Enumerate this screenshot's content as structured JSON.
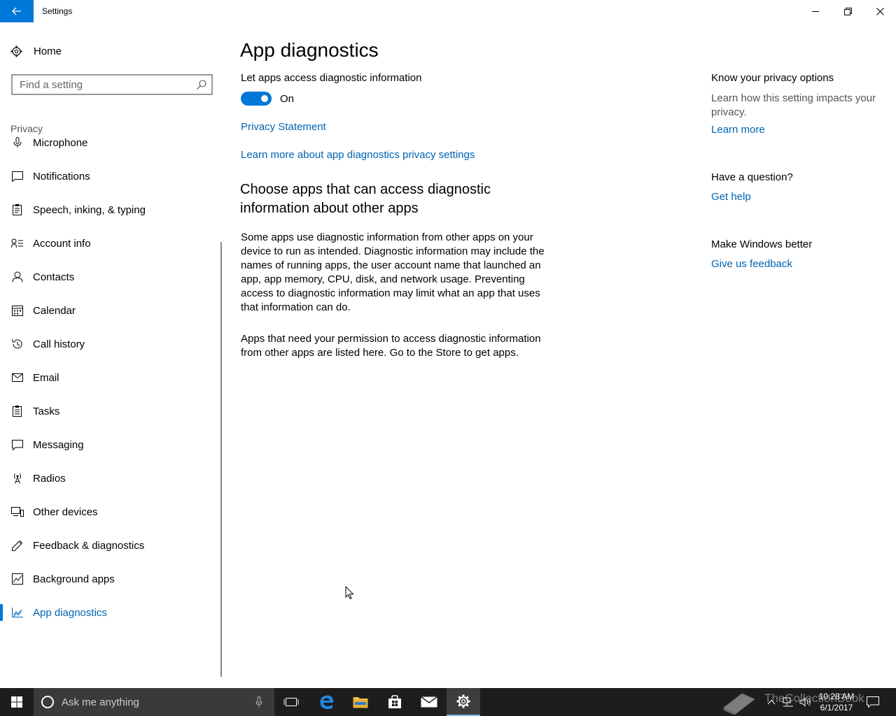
{
  "window": {
    "title": "Settings",
    "colors": {
      "accent": "#0078d7",
      "link": "#0063b1",
      "taskbar": "#1d1d1d"
    }
  },
  "sidebar": {
    "home_label": "Home",
    "search_placeholder": "Find a setting",
    "section_label": "Privacy",
    "items": [
      {
        "label": "Microphone",
        "icon": "microphone-icon"
      },
      {
        "label": "Notifications",
        "icon": "notifications-icon"
      },
      {
        "label": "Speech, inking, & typing",
        "icon": "speech-icon"
      },
      {
        "label": "Account info",
        "icon": "account-info-icon"
      },
      {
        "label": "Contacts",
        "icon": "contacts-icon"
      },
      {
        "label": "Calendar",
        "icon": "calendar-icon"
      },
      {
        "label": "Call history",
        "icon": "call-history-icon"
      },
      {
        "label": "Email",
        "icon": "email-icon"
      },
      {
        "label": "Tasks",
        "icon": "tasks-icon"
      },
      {
        "label": "Messaging",
        "icon": "messaging-icon"
      },
      {
        "label": "Radios",
        "icon": "radios-icon"
      },
      {
        "label": "Other devices",
        "icon": "other-devices-icon"
      },
      {
        "label": "Feedback & diagnostics",
        "icon": "feedback-icon"
      },
      {
        "label": "Background apps",
        "icon": "background-apps-icon"
      },
      {
        "label": "App diagnostics",
        "icon": "app-diagnostics-icon",
        "selected": true
      }
    ]
  },
  "main": {
    "title": "App diagnostics",
    "toggle_label": "Let apps access diagnostic information",
    "toggle_state": "On",
    "privacy_link": "Privacy Statement",
    "learn_more_link": "Learn more about app diagnostics privacy settings",
    "section_heading": "Choose apps that can access diagnostic information about other apps",
    "paragraph1": "Some apps use diagnostic information from other apps on your device to run as intended. Diagnostic information may include the names of running apps, the user account name that launched an app, app memory, CPU, disk, and network usage. Preventing access to diagnostic information may limit what an app that uses that information can do.",
    "paragraph2": "Apps that need your permission to access diagnostic information from other apps are listed here. Go to the Store to get apps."
  },
  "right_column": {
    "privacy_heading": "Know your privacy options",
    "privacy_text": "Learn how this setting impacts your privacy.",
    "privacy_link": "Learn more",
    "question_heading": "Have a question?",
    "question_link": "Get help",
    "better_heading": "Make Windows better",
    "better_link": "Give us feedback"
  },
  "taskbar": {
    "search_placeholder": "Ask me anything",
    "time": "10:28 AM",
    "date": "6/1/2017",
    "watermark": "TheCollectionBook"
  }
}
